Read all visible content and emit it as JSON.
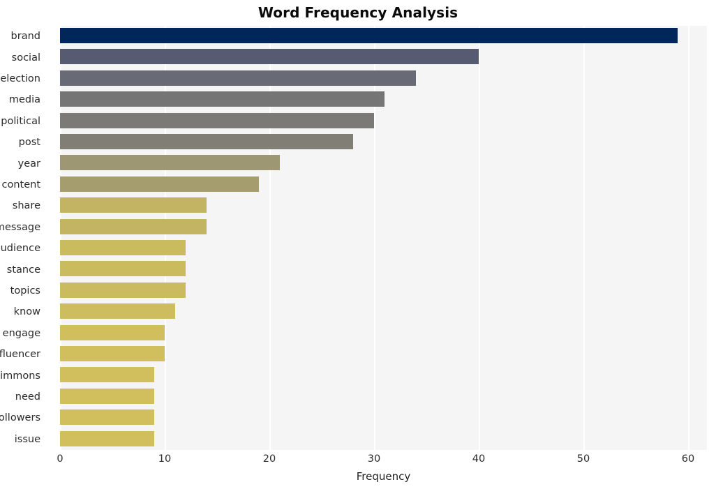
{
  "chart_data": {
    "type": "bar",
    "orientation": "horizontal",
    "title": "Word Frequency Analysis",
    "xlabel": "Frequency",
    "ylabel": "",
    "categories": [
      "brand",
      "social",
      "election",
      "media",
      "political",
      "post",
      "year",
      "content",
      "share",
      "message",
      "audience",
      "stance",
      "topics",
      "know",
      "engage",
      "influencer",
      "timmons",
      "need",
      "followers",
      "issue"
    ],
    "values": [
      59,
      40,
      34,
      31,
      30,
      28,
      21,
      19,
      14,
      14,
      12,
      12,
      12,
      11,
      10,
      10,
      9,
      9,
      9,
      9
    ],
    "bar_colors": [
      "#00265a",
      "#565b72",
      "#686b75",
      "#757575",
      "#7b7a76",
      "#807e75",
      "#9e9773",
      "#a69d6e",
      "#c2b463",
      "#c2b463",
      "#cbbb5f",
      "#cbbb5f",
      "#cbbb5f",
      "#cebd5e",
      "#d0bf5c",
      "#d0bf5c",
      "#d0bf5c",
      "#d0bf5c",
      "#d0bf5c",
      "#d0bf5c"
    ],
    "xlim": [
      0,
      61.8
    ],
    "xticks": [
      0,
      10,
      20,
      30,
      40,
      50,
      60
    ],
    "xtick_labels": [
      "0",
      "10",
      "20",
      "30",
      "40",
      "50",
      "60"
    ],
    "grid": "vertical-white",
    "legend": "none",
    "background_color": "#f5f5f6",
    "figure_background": "#ffffff",
    "gridline_color": "#ffffff"
  }
}
